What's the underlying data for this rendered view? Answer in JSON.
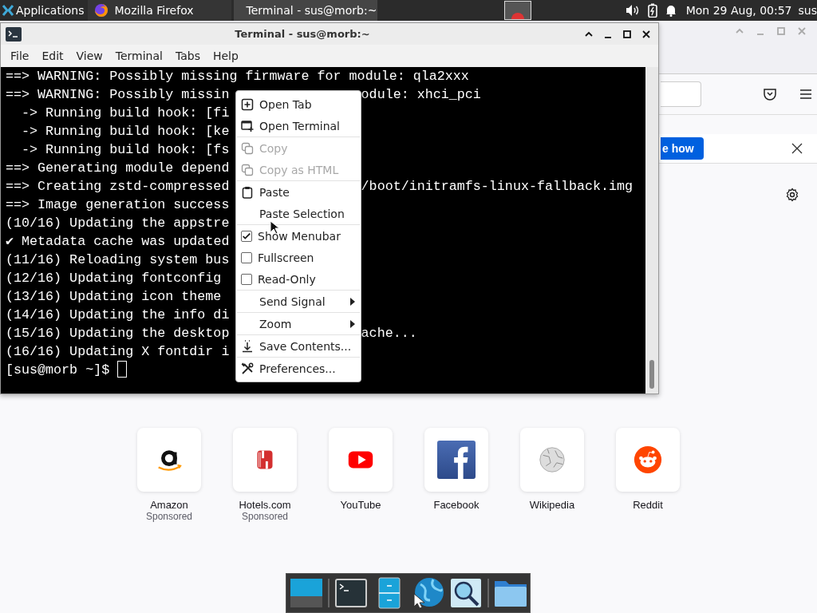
{
  "top_panel": {
    "applications": "Applications",
    "tasks": [
      {
        "title": "Mozilla Firefox",
        "selected": false
      },
      {
        "title": "Terminal - sus@morb:~",
        "selected": true
      }
    ],
    "clock": "Mon 29 Aug, 00:57",
    "user": "sus"
  },
  "firefox": {
    "notification": {
      "button": "e how"
    },
    "shortcuts": [
      {
        "name": "Amazon",
        "label": "Sponsored"
      },
      {
        "name": "Hotels.com",
        "label": "Sponsored"
      },
      {
        "name": "YouTube"
      },
      {
        "name": "Facebook"
      },
      {
        "name": "Wikipedia"
      },
      {
        "name": "Reddit"
      }
    ]
  },
  "terminal": {
    "title": "Terminal - sus@morb:~",
    "menu": [
      "File",
      "Edit",
      "View",
      "Terminal",
      "Tabs",
      "Help"
    ],
    "lines": [
      {
        "text": "==> WARNING: Possibly missing firmware for module: qla2xxx"
      },
      {
        "text": "==> WARNING: Possibly missin",
        "text_right": "odule: xhci_pci"
      },
      {
        "text": "  -> Running build hook: [fi"
      },
      {
        "text": "  -> Running build hook: [ke"
      },
      {
        "text": "  -> Running build hook: [fs"
      },
      {
        "text": "==> Generating module depend"
      },
      {
        "text": "==> Creating zstd-compressed",
        "text_right": "/boot/initramfs-linux-fallback.img"
      },
      {
        "text": "==> Image generation success"
      },
      {
        "text": "(10/16) Updating the appstre"
      },
      {
        "text": "✔ Metadata cache was updated"
      },
      {
        "text": "(11/16) Reloading system bus"
      },
      {
        "text": "(12/16) Updating fontconfig"
      },
      {
        "text": "(13/16) Updating icon theme"
      },
      {
        "text": "(14/16) Updating the info di"
      },
      {
        "text": "(15/16) Updating the desktop",
        "text_right": "ache..."
      },
      {
        "text": "(16/16) Updating X fontdir i"
      }
    ],
    "prompt": "[sus@morb ~]$"
  },
  "context_menu": {
    "groups": [
      [
        {
          "kind": "action",
          "label": "Open Tab",
          "disabled": false
        },
        {
          "kind": "action",
          "label": "Open Terminal",
          "disabled": false
        }
      ],
      [
        {
          "kind": "action",
          "label": "Copy",
          "disabled": true
        },
        {
          "kind": "action",
          "label": "Copy as HTML",
          "disabled": true
        }
      ],
      [
        {
          "kind": "action",
          "label": "Paste",
          "disabled": false
        },
        {
          "kind": "action",
          "label": "Paste Selection",
          "disabled": false
        }
      ],
      [
        {
          "kind": "check",
          "label": "Show Menubar",
          "checked": true,
          "disabled": false
        },
        {
          "kind": "check",
          "label": "Fullscreen",
          "checked": false,
          "disabled": false
        },
        {
          "kind": "check",
          "label": "Read-Only",
          "checked": false,
          "disabled": false
        }
      ],
      [
        {
          "kind": "submenu",
          "label": "Send Signal",
          "disabled": false
        }
      ],
      [
        {
          "kind": "submenu",
          "label": "Zoom",
          "disabled": false
        }
      ],
      [
        {
          "kind": "action",
          "label": "Save Contents...",
          "disabled": false
        }
      ],
      [
        {
          "kind": "action",
          "label": "Preferences...",
          "disabled": false
        }
      ]
    ]
  }
}
